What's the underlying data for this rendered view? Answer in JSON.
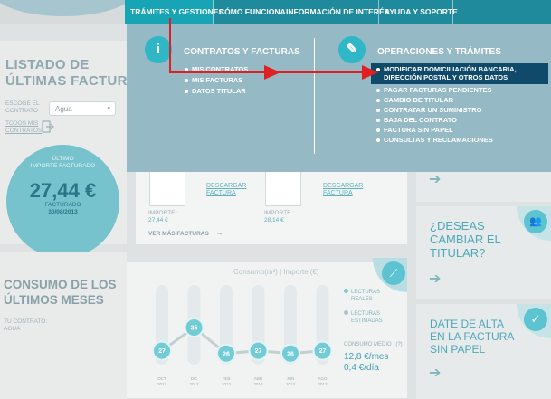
{
  "nav": {
    "tabs": [
      "Trámites y gestiones",
      "Cómo funciona",
      "Información de interés",
      "Ayuda y soporte"
    ]
  },
  "left": {
    "title_line1": "Listado de",
    "title_line2": "últimas facturas",
    "choose_label_1": "Escoge el",
    "choose_label_2": "contrato",
    "select_value": "Agua",
    "my_contracts_1": "todos mis",
    "my_contracts_2": "contratos",
    "last_invoice_1": "Último",
    "last_invoice_2": "importe facturado",
    "amount": "27,44 €",
    "billed": "facturado",
    "date": "30/08/2013"
  },
  "invoices": {
    "download_1": "Descargar",
    "download_2": "factura",
    "import_label": "Importe :",
    "amount_1": "27,44 €",
    "amount_2": "28,14 €",
    "more": "Ver más facturas"
  },
  "consumption": {
    "title_line1": "Consumo de los",
    "title_line2": "últimos meses",
    "contract_label": "tu contrato:",
    "contract_value": "agua"
  },
  "chart_data": {
    "type": "line",
    "title": "Consumo(m³) | Importe (€)",
    "categories": [
      "Oct",
      "Dic",
      "Feb",
      "Abr",
      "Jun",
      "Ago"
    ],
    "years": [
      "2012",
      "2012",
      "2013",
      "2013",
      "2013",
      "2013"
    ],
    "values": [
      27,
      35,
      26,
      27,
      26,
      27
    ],
    "legend": [
      "Lecturas reales",
      "Lecturas estimadas"
    ],
    "avg_label": "Consumo medio",
    "avg_help": "(?)",
    "avg_month": "12,8 €/mes",
    "avg_day": "0,4 €/día"
  },
  "right": {
    "titular_line1": "¿Deseas",
    "titular_line2": "cambiar el",
    "titular_line3": "titular?",
    "paper_line1": "Date de alta",
    "paper_line2": "en la factura",
    "paper_line3": "sin papel"
  },
  "dropdown": {
    "col1_title": "Contratos y facturas",
    "col1_items": [
      "Mis contratos",
      "Mis facturas",
      "Datos titular"
    ],
    "col2_title": "Operaciones y trámites",
    "col2_items": [
      "Modificar domiciliación bancaria, dirección postal y otros datos",
      "Pagar facturas pendientes",
      "Cambio de titular",
      "Contratar un suministro",
      "Baja del contrato",
      "Factura sin papel",
      "Consultas y reclamaciones"
    ]
  },
  "colors": {
    "nav": "#1f8a9c",
    "active_tab": "#17a5b5",
    "overlay": "#96b9c6",
    "highlight": "#0f4a6a",
    "arrow": "#e02020"
  }
}
